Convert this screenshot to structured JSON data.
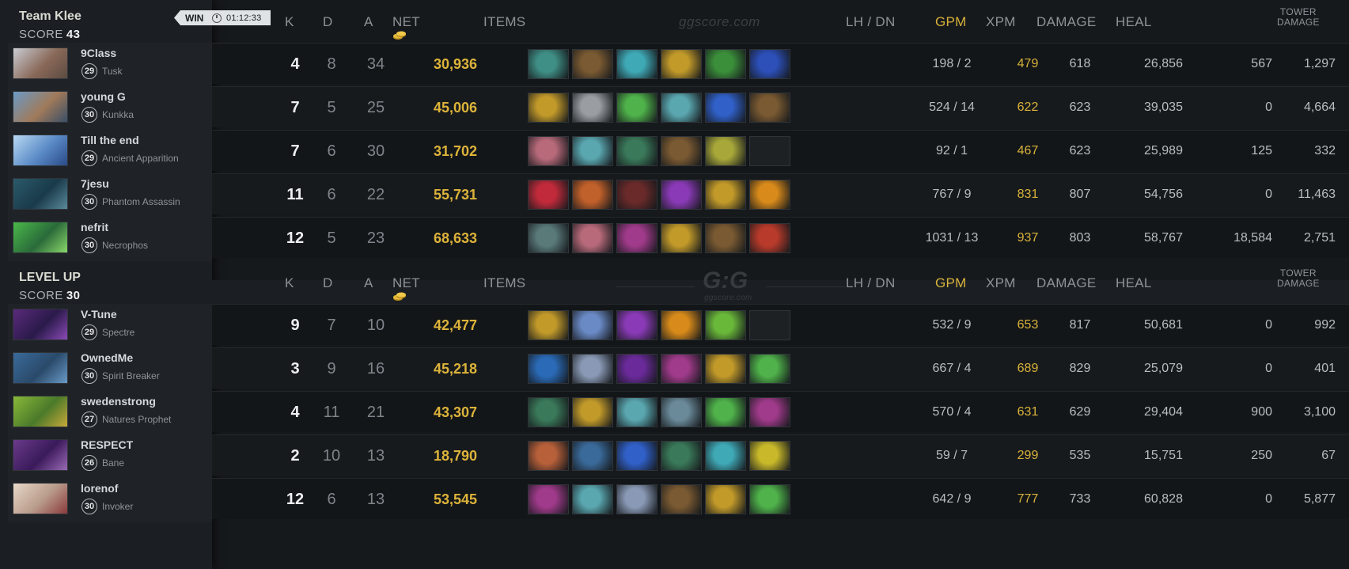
{
  "headers": {
    "k": "K",
    "d": "D",
    "a": "A",
    "net": "NET",
    "items": "ITEMS",
    "lhdn": "LH  /  DN",
    "gpm": "GPM",
    "xpm": "XPM",
    "damage": "DAMAGE",
    "heal": "HEAL",
    "tower_line1": "TOWER",
    "tower_line2": "DAMAGE"
  },
  "watermark": {
    "site": "ggscore.com",
    "logo": "G:G",
    "logo_sub": "ggscore.com"
  },
  "colors": {
    "gold": "#d8b23a",
    "bg": "#16191c",
    "panel": "#1b1e22"
  },
  "teams": [
    {
      "name": "Team Klee",
      "score_label": "SCORE",
      "score": "43",
      "result": "WIN",
      "duration": "01:12:33",
      "players": [
        {
          "name": "9Class",
          "level": "29",
          "hero": "Tusk",
          "k": "4",
          "d": "8",
          "a": "34",
          "net": "30,936",
          "lh_dn": "198  /  2",
          "gpm": "479",
          "xpm": "618",
          "damage": "26,856",
          "heal": "567",
          "tower": "1,297",
          "portrait": [
            "#c9ccd2",
            "#8a6a5a",
            "#5b4a40"
          ],
          "items": [
            "#3f8f86",
            "#7a5a32",
            "#3fa9b6",
            "#c29a2a",
            "#3b8f3a",
            "#2c4fb8"
          ]
        },
        {
          "name": "young G",
          "level": "30",
          "hero": "Kunkka",
          "k": "7",
          "d": "5",
          "a": "25",
          "net": "45,006",
          "lh_dn": "524  /  14",
          "gpm": "622",
          "xpm": "623",
          "damage": "39,035",
          "heal": "0",
          "tower": "4,664",
          "portrait": [
            "#6b9ac6",
            "#a07a5a",
            "#3a4e66"
          ],
          "items": [
            "#c29a2a",
            "#9a9da2",
            "#4fb24a",
            "#5aa7b0",
            "#3060c8",
            "#7a5a32"
          ]
        },
        {
          "name": "Till the end",
          "level": "29",
          "hero": "Ancient Apparition",
          "k": "7",
          "d": "6",
          "a": "30",
          "net": "31,702",
          "lh_dn": "92  /  1",
          "gpm": "467",
          "xpm": "623",
          "damage": "25,989",
          "heal": "125",
          "tower": "332",
          "portrait": [
            "#b8d8f2",
            "#5a8ac6",
            "#2a4a86"
          ],
          "items": [
            "#b86a7a",
            "#5aa7b0",
            "#3a7a5a",
            "#7a5a32",
            "#a8a83a",
            "#202326"
          ]
        },
        {
          "name": "7jesu",
          "level": "30",
          "hero": "Phantom Assassin",
          "k": "11",
          "d": "6",
          "a": "22",
          "net": "55,731",
          "lh_dn": "767  /  9",
          "gpm": "831",
          "xpm": "807",
          "damage": "54,756",
          "heal": "0",
          "tower": "11,463",
          "portrait": [
            "#2a5a6a",
            "#1a3a4a",
            "#5a8a9a"
          ],
          "items": [
            "#c02a3a",
            "#c0602a",
            "#6a2a2a",
            "#8a3ab6",
            "#c29a2a",
            "#d88a1a"
          ]
        },
        {
          "name": "nefrit",
          "level": "30",
          "hero": "Necrophos",
          "k": "12",
          "d": "5",
          "a": "23",
          "net": "68,633",
          "lh_dn": "1031  /  13",
          "gpm": "937",
          "xpm": "803",
          "damage": "58,767",
          "heal": "18,584",
          "tower": "2,751",
          "portrait": [
            "#4ab84a",
            "#2a6a3a",
            "#8ad86a"
          ],
          "items": [
            "#5a7a7a",
            "#b86a7a",
            "#a03a8a",
            "#c29a2a",
            "#7a5a32",
            "#b83a2a"
          ]
        }
      ]
    },
    {
      "name": "LEVEL UP",
      "score_label": "SCORE",
      "score": "30",
      "players": [
        {
          "name": "V-Tune",
          "level": "29",
          "hero": "Spectre",
          "k": "9",
          "d": "7",
          "a": "10",
          "net": "42,477",
          "lh_dn": "532  /  9",
          "gpm": "653",
          "xpm": "817",
          "damage": "50,681",
          "heal": "0",
          "tower": "992",
          "portrait": [
            "#5a2a7a",
            "#2a1a4a",
            "#8a4ab6"
          ],
          "items": [
            "#c29a2a",
            "#6a8ac6",
            "#8a3ab6",
            "#d88a1a",
            "#6ab83a",
            "#202326"
          ]
        },
        {
          "name": "OwnedMe",
          "level": "30",
          "hero": "Spirit Breaker",
          "k": "3",
          "d": "9",
          "a": "16",
          "net": "45,218",
          "lh_dn": "667  /  4",
          "gpm": "689",
          "xpm": "829",
          "damage": "25,079",
          "heal": "0",
          "tower": "401",
          "portrait": [
            "#3a6a9a",
            "#2a4a6a",
            "#6a9ac6"
          ],
          "items": [
            "#2a6ab6",
            "#8a9ab6",
            "#6a2a9a",
            "#a03a8a",
            "#c29a2a",
            "#4fb24a"
          ]
        },
        {
          "name": "swedenstrong",
          "level": "27",
          "hero": "Natures Prophet",
          "k": "4",
          "d": "11",
          "a": "21",
          "net": "43,307",
          "lh_dn": "570  /  4",
          "gpm": "631",
          "xpm": "629",
          "damage": "29,404",
          "heal": "900",
          "tower": "3,100",
          "portrait": [
            "#8ab83a",
            "#4a7a2a",
            "#c8a83a"
          ],
          "items": [
            "#3a7a5a",
            "#c29a2a",
            "#5aa7b0",
            "#6a8a9a",
            "#4fb24a",
            "#a03a8a"
          ]
        },
        {
          "name": "RESPECT",
          "level": "26",
          "hero": "Bane",
          "k": "2",
          "d": "10",
          "a": "13",
          "net": "18,790",
          "lh_dn": "59  /  7",
          "gpm": "299",
          "xpm": "535",
          "damage": "15,751",
          "heal": "250",
          "tower": "67",
          "portrait": [
            "#6a3a8a",
            "#3a1a5a",
            "#9a6ab6"
          ],
          "items": [
            "#b8603a",
            "#3a6a9a",
            "#3060c8",
            "#3a7a5a",
            "#3fa9b6",
            "#c8b82a"
          ]
        },
        {
          "name": "lorenof",
          "level": "30",
          "hero": "Invoker",
          "k": "12",
          "d": "6",
          "a": "13",
          "net": "53,545",
          "lh_dn": "642  /  9",
          "gpm": "777",
          "xpm": "733",
          "damage": "60,828",
          "heal": "0",
          "tower": "5,877",
          "portrait": [
            "#e8d8c8",
            "#b89a8a",
            "#8a3a3a"
          ],
          "items": [
            "#a03a8a",
            "#5aa7b0",
            "#8a9ab6",
            "#7a5a32",
            "#c29a2a",
            "#4fb24a"
          ]
        }
      ]
    }
  ]
}
